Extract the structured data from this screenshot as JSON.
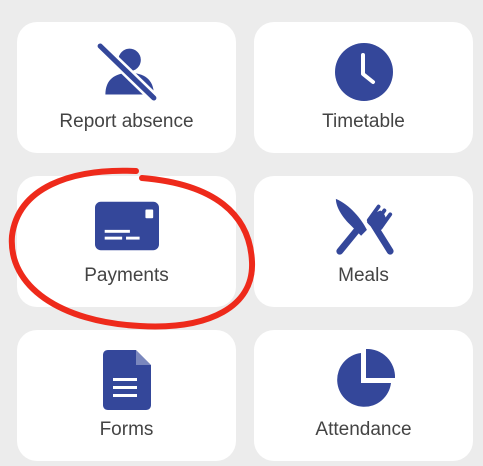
{
  "tiles": [
    {
      "label": "Report absence",
      "icon": "person-off-icon"
    },
    {
      "label": "Timetable",
      "icon": "clock-icon"
    },
    {
      "label": "Payments",
      "icon": "credit-card-icon"
    },
    {
      "label": "Meals",
      "icon": "fork-knife-icon"
    },
    {
      "label": "Forms",
      "icon": "document-icon"
    },
    {
      "label": "Attendance",
      "icon": "pie-chart-icon"
    }
  ],
  "colors": {
    "icon": "#34479a",
    "label": "#444444",
    "tile_bg": "#ffffff",
    "page_bg": "#ececec",
    "annotation": "#ee2a1b"
  }
}
